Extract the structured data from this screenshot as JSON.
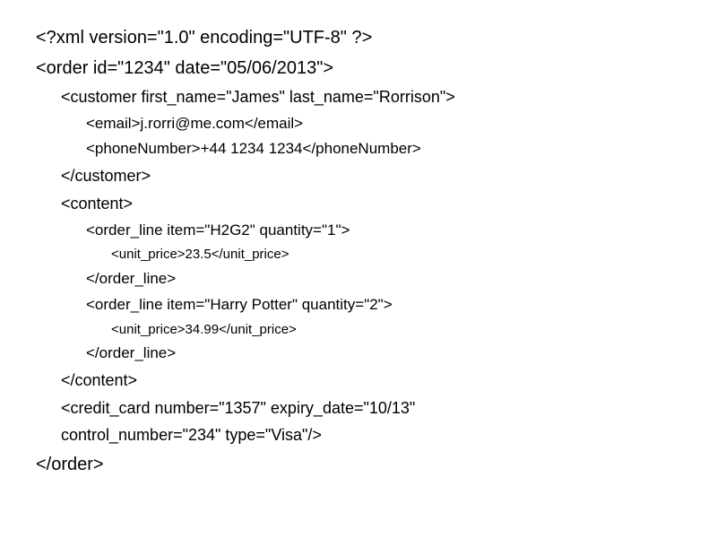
{
  "xml_decl": "<?xml version=\"1.0\" encoding=\"UTF-8\" ?>",
  "order_open": "<order id=\"1234\" date=\"05/06/2013\">",
  "customer_open": "<customer first_name=\"James\" last_name=\"Rorrison\">",
  "email": "<email>j.rorri@me.com</email>",
  "phone": "<phoneNumber>+44 1234 1234</phoneNumber>",
  "customer_close": "</customer>",
  "content_open": "<content>",
  "ol1_open": "<order_line item=\"H2G2\" quantity=\"1\">",
  "ol1_price": "<unit_price>23.5</unit_price>",
  "ol1_close": "</order_line>",
  "ol2_open": "<order_line item=\"Harry Potter\" quantity=\"2\">",
  "ol2_price": "<unit_price>34.99</unit_price>",
  "ol2_close": "</order_line>",
  "content_close": "</content>",
  "credit_card_l1": "<credit_card number=\"1357\" expiry_date=\"10/13\"",
  "credit_card_l2": "control_number=\"234\" type=\"Visa\"/>",
  "order_close": "</order>"
}
